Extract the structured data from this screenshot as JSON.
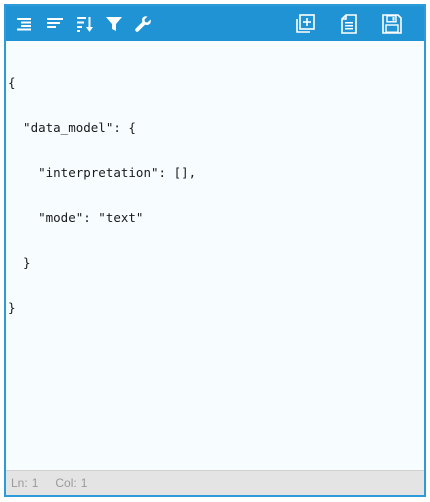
{
  "toolbar": {
    "icons": [
      "format-icon",
      "compact-icon",
      "sort-icon",
      "filter-icon",
      "repair-icon",
      "copy-icon",
      "paste-icon",
      "save-icon"
    ],
    "accent": "#1f93d4"
  },
  "code": {
    "lines": [
      "{",
      "  \"data_model\": {",
      "    \"interpretation\": [],",
      "    \"mode\": \"text\"",
      "  }",
      "}"
    ]
  },
  "status": {
    "ln_label": "Ln:",
    "ln_value": "1",
    "col_label": "Col:",
    "col_value": "1"
  }
}
